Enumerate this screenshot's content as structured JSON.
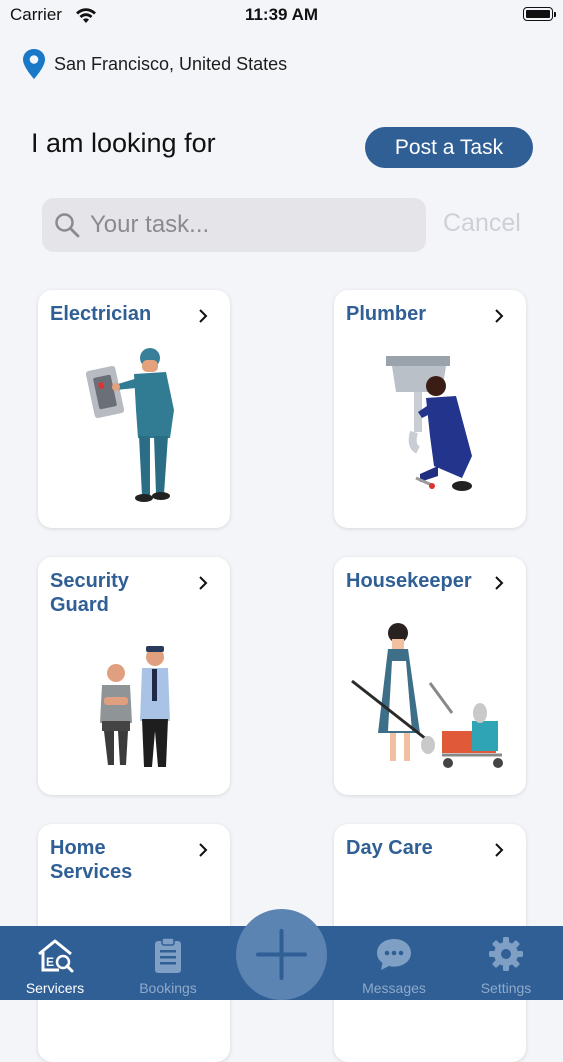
{
  "status_bar": {
    "carrier": "Carrier",
    "time": "11:39 AM"
  },
  "location": {
    "text": "San Francisco, United States",
    "icon": "location-pin-icon"
  },
  "heading": {
    "title": "I am looking for",
    "post_task_label": "Post a Task"
  },
  "search": {
    "placeholder": "Your task...",
    "cancel_label": "Cancel"
  },
  "categories": [
    {
      "title": "Electrician"
    },
    {
      "title": "Plumber"
    },
    {
      "title": "Security Guard"
    },
    {
      "title": "Housekeeper"
    },
    {
      "title": "Home Services"
    },
    {
      "title": "Day Care"
    }
  ],
  "tabbar": {
    "items": [
      {
        "label": "Servicers",
        "icon": "servicers-icon",
        "active": true
      },
      {
        "label": "Bookings",
        "icon": "clipboard-icon",
        "active": false
      },
      {
        "label": "Messages",
        "icon": "chat-bubble-icon",
        "active": false
      },
      {
        "label": "Settings",
        "icon": "gear-icon",
        "active": false
      }
    ],
    "fab_icon": "plus-icon"
  },
  "colors": {
    "brand": "#2f5f95",
    "fab": "#5b84b2",
    "background": "#f4f5f9"
  }
}
